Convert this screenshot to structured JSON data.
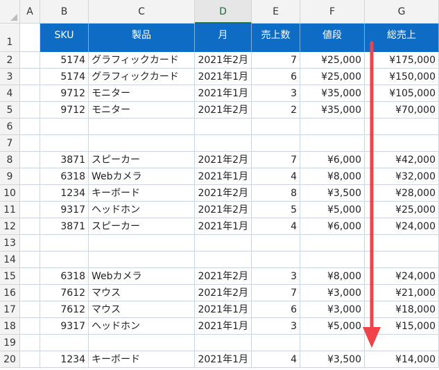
{
  "columns": [
    "A",
    "B",
    "C",
    "D",
    "E",
    "F",
    "G"
  ],
  "selected_column": "D",
  "header": {
    "sku": "SKU",
    "product": "製品",
    "month": "月",
    "qty": "売上数",
    "price": "値段",
    "total": "総売上"
  },
  "row_numbers": [
    "1",
    "2",
    "3",
    "4",
    "5",
    "6",
    "7",
    "8",
    "9",
    "10",
    "11",
    "12",
    "13",
    "14",
    "15",
    "16",
    "17",
    "18",
    "19",
    "20"
  ],
  "rows": [
    {
      "sku": "5174",
      "product": "グラフィックカード",
      "month": "2021年2月",
      "qty": "7",
      "price": "¥25,000",
      "total": "¥175,000"
    },
    {
      "sku": "5174",
      "product": "グラフィックカード",
      "month": "2021年1月",
      "qty": "6",
      "price": "¥25,000",
      "total": "¥150,000"
    },
    {
      "sku": "9712",
      "product": "モニター",
      "month": "2021年1月",
      "qty": "3",
      "price": "¥35,000",
      "total": "¥105,000"
    },
    {
      "sku": "9712",
      "product": "モニター",
      "month": "2021年2月",
      "qty": "2",
      "price": "¥35,000",
      "total": "¥70,000"
    },
    {
      "sku": "",
      "product": "",
      "month": "",
      "qty": "",
      "price": "",
      "total": ""
    },
    {
      "sku": "",
      "product": "",
      "month": "",
      "qty": "",
      "price": "",
      "total": ""
    },
    {
      "sku": "3871",
      "product": "スピーカー",
      "month": "2021年2月",
      "qty": "7",
      "price": "¥6,000",
      "total": "¥42,000"
    },
    {
      "sku": "6318",
      "product": "Webカメラ",
      "month": "2021年1月",
      "qty": "4",
      "price": "¥8,000",
      "total": "¥32,000"
    },
    {
      "sku": "1234",
      "product": "キーボード",
      "month": "2021年2月",
      "qty": "8",
      "price": "¥3,500",
      "total": "¥28,000"
    },
    {
      "sku": "9317",
      "product": "ヘッドホン",
      "month": "2021年2月",
      "qty": "5",
      "price": "¥5,000",
      "total": "¥25,000"
    },
    {
      "sku": "3871",
      "product": "スピーカー",
      "month": "2021年1月",
      "qty": "4",
      "price": "¥6,000",
      "total": "¥24,000"
    },
    {
      "sku": "",
      "product": "",
      "month": "",
      "qty": "",
      "price": "",
      "total": ""
    },
    {
      "sku": "",
      "product": "",
      "month": "",
      "qty": "",
      "price": "",
      "total": ""
    },
    {
      "sku": "6318",
      "product": "Webカメラ",
      "month": "2021年2月",
      "qty": "3",
      "price": "¥8,000",
      "total": "¥24,000"
    },
    {
      "sku": "7612",
      "product": "マウス",
      "month": "2021年2月",
      "qty": "7",
      "price": "¥3,000",
      "total": "¥21,000"
    },
    {
      "sku": "7612",
      "product": "マウス",
      "month": "2021年1月",
      "qty": "6",
      "price": "¥3,000",
      "total": "¥18,000"
    },
    {
      "sku": "9317",
      "product": "ヘッドホン",
      "month": "2021年1月",
      "qty": "3",
      "price": "¥5,000",
      "total": "¥15,000"
    },
    {
      "sku": "",
      "product": "",
      "month": "",
      "qty": "",
      "price": "",
      "total": ""
    },
    {
      "sku": "1234",
      "product": "キーボード",
      "month": "2021年1月",
      "qty": "4",
      "price": "¥3,500",
      "total": "¥14,000"
    }
  ],
  "colors": {
    "header_fill": "#0f6cc5",
    "header_text": "#ffffff",
    "gridline": "#c6d8e8",
    "annotation_arrow": "#f0424a"
  },
  "annotation": {
    "icon": "down-arrow-icon"
  }
}
